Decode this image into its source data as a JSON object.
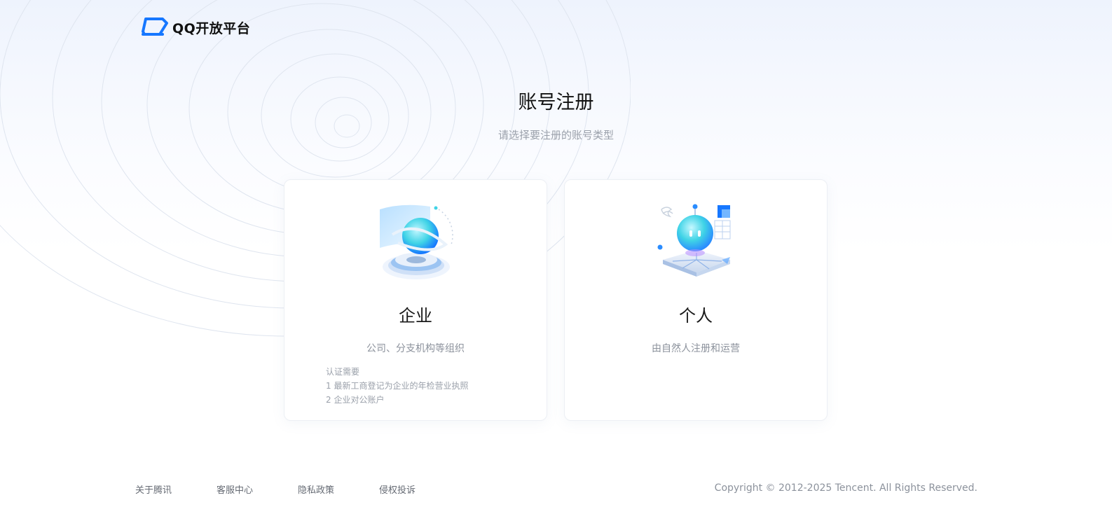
{
  "header": {
    "logo_text": "QQ开放平台"
  },
  "main": {
    "title": "账号注册",
    "subtitle": "请选择要注册的账号类型"
  },
  "cards": {
    "enterprise": {
      "title": "企业",
      "desc": "公司、分支机构等组织",
      "requirements_label": "认证需要",
      "requirements": [
        "1 最新工商登记为企业的年检营业执照",
        "2 企业对公账户"
      ]
    },
    "personal": {
      "title": "个人",
      "desc": "由自然人注册和运营"
    }
  },
  "footer": {
    "links": [
      "关于腾讯",
      "客服中心",
      "隐私政策",
      "侵权投诉"
    ],
    "copyright": "Copyright © 2012-2025 Tencent. All Rights Reserved."
  },
  "colors": {
    "brand_blue": "#1677ff",
    "accent_cyan": "#3fd3e6"
  }
}
